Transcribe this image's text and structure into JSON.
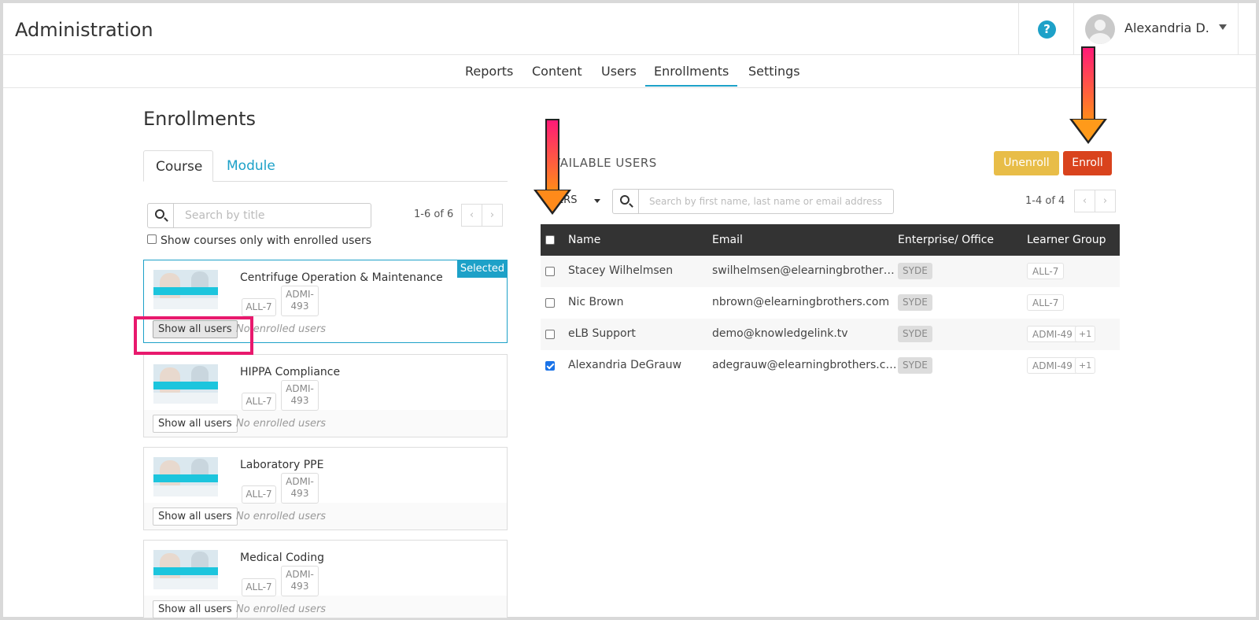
{
  "header": {
    "title": "Administration",
    "help_icon": "question-circle-icon",
    "user_name": "Alexandria D."
  },
  "nav": {
    "items": [
      "Reports",
      "Content",
      "Users",
      "Enrollments",
      "Settings"
    ],
    "active": "Enrollments"
  },
  "enrollments": {
    "title": "Enrollments",
    "tabs": [
      "Course",
      "Module"
    ],
    "search_placeholder": "Search by title",
    "pagination": "1-6 of 6",
    "filter_checkbox_label": "Show courses only with enrolled users",
    "selected_label": "Selected",
    "show_all_label": "Show all users",
    "no_enrolled_label": "No enrolled users",
    "courses": [
      {
        "title": "Centrifuge Operation & Maintenance",
        "tag1": "ALL-7",
        "tag2a": "ADMI-",
        "tag2b": "493",
        "selected": true
      },
      {
        "title": "HIPPA Compliance",
        "tag1": "ALL-7",
        "tag2a": "ADMI-",
        "tag2b": "493",
        "selected": false
      },
      {
        "title": "Laboratory PPE",
        "tag1": "ALL-7",
        "tag2a": "ADMI-",
        "tag2b": "493",
        "selected": false
      },
      {
        "title": "Medical Coding",
        "tag1": "ALL-7",
        "tag2a": "ADMI-",
        "tag2b": "493",
        "selected": false
      }
    ]
  },
  "available_users": {
    "title": "VAILABLE USERS",
    "unenroll_label": "Unenroll",
    "enroll_label": "Enroll",
    "filters_label": "TERS",
    "search_placeholder": "Search by first name, last name or email address",
    "pagination": "1-4 of 4",
    "columns": [
      "Name",
      "Email",
      "Enterprise/ Office",
      "Learner Group"
    ],
    "rows": [
      {
        "name": "Stacey Wilhelmsen",
        "email": "swilhelmsen@elearningbrothers.c...",
        "enterprise": "SYDE",
        "group": "ALL-7",
        "more": "",
        "checked": false
      },
      {
        "name": "Nic Brown",
        "email": "nbrown@elearningbrothers.com",
        "enterprise": "SYDE",
        "group": "ALL-7",
        "more": "",
        "checked": false
      },
      {
        "name": "eLB Support",
        "email": "demo@knowledgelink.tv",
        "enterprise": "SYDE",
        "group": "ADMI-49",
        "more": "+1",
        "checked": false
      },
      {
        "name": "Alexandria DeGrauw",
        "email": "adegrauw@elearningbrothers.com",
        "enterprise": "SYDE",
        "group": "ADMI-49",
        "more": "+1",
        "checked": true
      }
    ]
  },
  "annotation_colors": {
    "highlight_box": "#e8196d",
    "arrow_top": "#ff1a77",
    "arrow_bottom": "#ff8a1a"
  }
}
